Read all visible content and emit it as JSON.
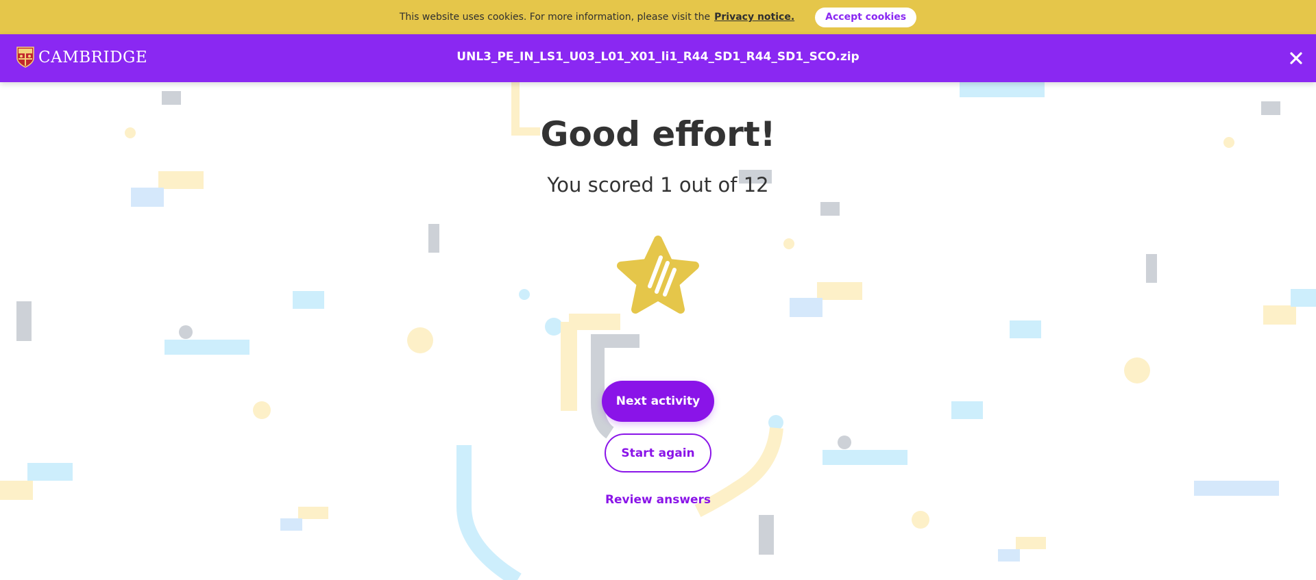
{
  "cookie_banner": {
    "text": "This website uses cookies. For more information, please visit the",
    "link_label": "Privacy notice.",
    "accept_label": "Accept cookies"
  },
  "header": {
    "brand": "CAMBRIDGE",
    "file_title": "UNL3_PE_IN_LS1_U03_L01_X01_li1_R44_SD1_R44_SD1_SCO.zip",
    "close_icon": "close-icon"
  },
  "result": {
    "headline": "Good effort!",
    "score_text": "You scored 1 out of 12",
    "icon": "star-icon"
  },
  "actions": {
    "next_label": "Next activity",
    "start_again_label": "Start again",
    "review_label": "Review answers"
  },
  "colors": {
    "cookie_bar": "#e5c64a",
    "brand_purple": "#8a28f2",
    "button_purple": "#8a14e8",
    "star_yellow": "#e5c64a",
    "text_dark": "#333333"
  }
}
